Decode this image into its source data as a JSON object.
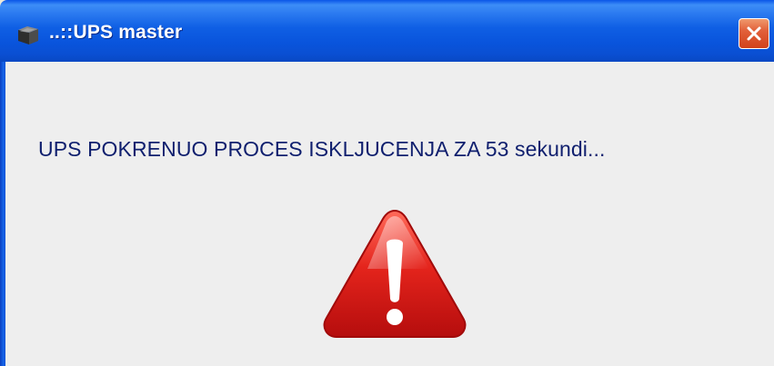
{
  "window": {
    "title": "..::UPS master",
    "app_icon": "ups-device-icon",
    "close_icon": "close-icon"
  },
  "dialog": {
    "message": "UPS POKRENUO PROCES ISKLJUCENJA ZA 53 sekundi...",
    "warning_icon": "warning-icon"
  },
  "colors": {
    "titlebar": "#0a54dc",
    "close_button": "#e2603a",
    "body_background": "#eeeeee",
    "message_text": "#0f1f6e",
    "warning_red": "#d61a1a"
  }
}
